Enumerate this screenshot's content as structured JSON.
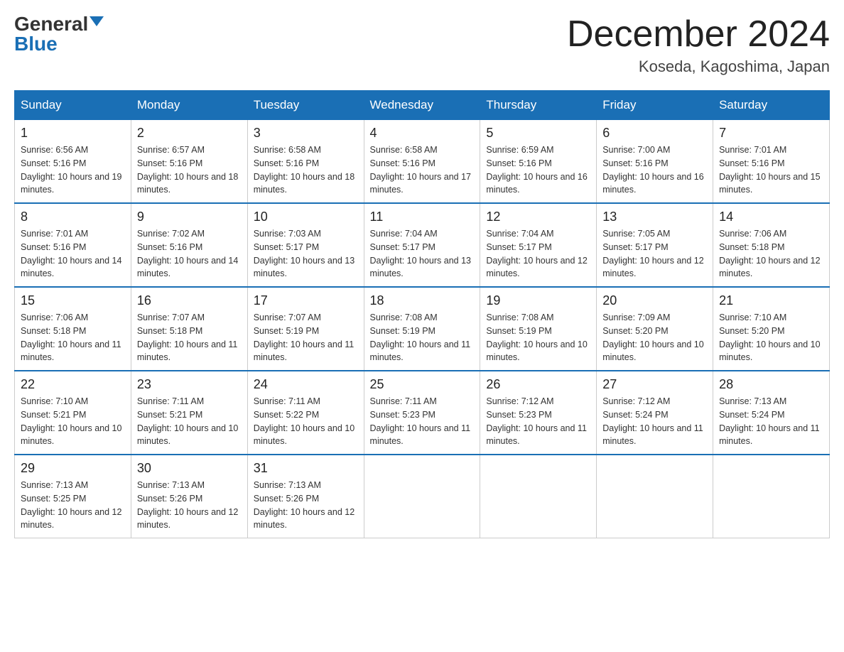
{
  "logo": {
    "general": "General",
    "blue": "Blue"
  },
  "title": {
    "month_year": "December 2024",
    "location": "Koseda, Kagoshima, Japan"
  },
  "days_of_week": [
    "Sunday",
    "Monday",
    "Tuesday",
    "Wednesday",
    "Thursday",
    "Friday",
    "Saturday"
  ],
  "weeks": [
    [
      {
        "day": "1",
        "sunrise": "6:56 AM",
        "sunset": "5:16 PM",
        "daylight": "10 hours and 19 minutes."
      },
      {
        "day": "2",
        "sunrise": "6:57 AM",
        "sunset": "5:16 PM",
        "daylight": "10 hours and 18 minutes."
      },
      {
        "day": "3",
        "sunrise": "6:58 AM",
        "sunset": "5:16 PM",
        "daylight": "10 hours and 18 minutes."
      },
      {
        "day": "4",
        "sunrise": "6:58 AM",
        "sunset": "5:16 PM",
        "daylight": "10 hours and 17 minutes."
      },
      {
        "day": "5",
        "sunrise": "6:59 AM",
        "sunset": "5:16 PM",
        "daylight": "10 hours and 16 minutes."
      },
      {
        "day": "6",
        "sunrise": "7:00 AM",
        "sunset": "5:16 PM",
        "daylight": "10 hours and 16 minutes."
      },
      {
        "day": "7",
        "sunrise": "7:01 AM",
        "sunset": "5:16 PM",
        "daylight": "10 hours and 15 minutes."
      }
    ],
    [
      {
        "day": "8",
        "sunrise": "7:01 AM",
        "sunset": "5:16 PM",
        "daylight": "10 hours and 14 minutes."
      },
      {
        "day": "9",
        "sunrise": "7:02 AM",
        "sunset": "5:16 PM",
        "daylight": "10 hours and 14 minutes."
      },
      {
        "day": "10",
        "sunrise": "7:03 AM",
        "sunset": "5:17 PM",
        "daylight": "10 hours and 13 minutes."
      },
      {
        "day": "11",
        "sunrise": "7:04 AM",
        "sunset": "5:17 PM",
        "daylight": "10 hours and 13 minutes."
      },
      {
        "day": "12",
        "sunrise": "7:04 AM",
        "sunset": "5:17 PM",
        "daylight": "10 hours and 12 minutes."
      },
      {
        "day": "13",
        "sunrise": "7:05 AM",
        "sunset": "5:17 PM",
        "daylight": "10 hours and 12 minutes."
      },
      {
        "day": "14",
        "sunrise": "7:06 AM",
        "sunset": "5:18 PM",
        "daylight": "10 hours and 12 minutes."
      }
    ],
    [
      {
        "day": "15",
        "sunrise": "7:06 AM",
        "sunset": "5:18 PM",
        "daylight": "10 hours and 11 minutes."
      },
      {
        "day": "16",
        "sunrise": "7:07 AM",
        "sunset": "5:18 PM",
        "daylight": "10 hours and 11 minutes."
      },
      {
        "day": "17",
        "sunrise": "7:07 AM",
        "sunset": "5:19 PM",
        "daylight": "10 hours and 11 minutes."
      },
      {
        "day": "18",
        "sunrise": "7:08 AM",
        "sunset": "5:19 PM",
        "daylight": "10 hours and 11 minutes."
      },
      {
        "day": "19",
        "sunrise": "7:08 AM",
        "sunset": "5:19 PM",
        "daylight": "10 hours and 10 minutes."
      },
      {
        "day": "20",
        "sunrise": "7:09 AM",
        "sunset": "5:20 PM",
        "daylight": "10 hours and 10 minutes."
      },
      {
        "day": "21",
        "sunrise": "7:10 AM",
        "sunset": "5:20 PM",
        "daylight": "10 hours and 10 minutes."
      }
    ],
    [
      {
        "day": "22",
        "sunrise": "7:10 AM",
        "sunset": "5:21 PM",
        "daylight": "10 hours and 10 minutes."
      },
      {
        "day": "23",
        "sunrise": "7:11 AM",
        "sunset": "5:21 PM",
        "daylight": "10 hours and 10 minutes."
      },
      {
        "day": "24",
        "sunrise": "7:11 AM",
        "sunset": "5:22 PM",
        "daylight": "10 hours and 10 minutes."
      },
      {
        "day": "25",
        "sunrise": "7:11 AM",
        "sunset": "5:23 PM",
        "daylight": "10 hours and 11 minutes."
      },
      {
        "day": "26",
        "sunrise": "7:12 AM",
        "sunset": "5:23 PM",
        "daylight": "10 hours and 11 minutes."
      },
      {
        "day": "27",
        "sunrise": "7:12 AM",
        "sunset": "5:24 PM",
        "daylight": "10 hours and 11 minutes."
      },
      {
        "day": "28",
        "sunrise": "7:13 AM",
        "sunset": "5:24 PM",
        "daylight": "10 hours and 11 minutes."
      }
    ],
    [
      {
        "day": "29",
        "sunrise": "7:13 AM",
        "sunset": "5:25 PM",
        "daylight": "10 hours and 12 minutes."
      },
      {
        "day": "30",
        "sunrise": "7:13 AM",
        "sunset": "5:26 PM",
        "daylight": "10 hours and 12 minutes."
      },
      {
        "day": "31",
        "sunrise": "7:13 AM",
        "sunset": "5:26 PM",
        "daylight": "10 hours and 12 minutes."
      },
      null,
      null,
      null,
      null
    ]
  ]
}
